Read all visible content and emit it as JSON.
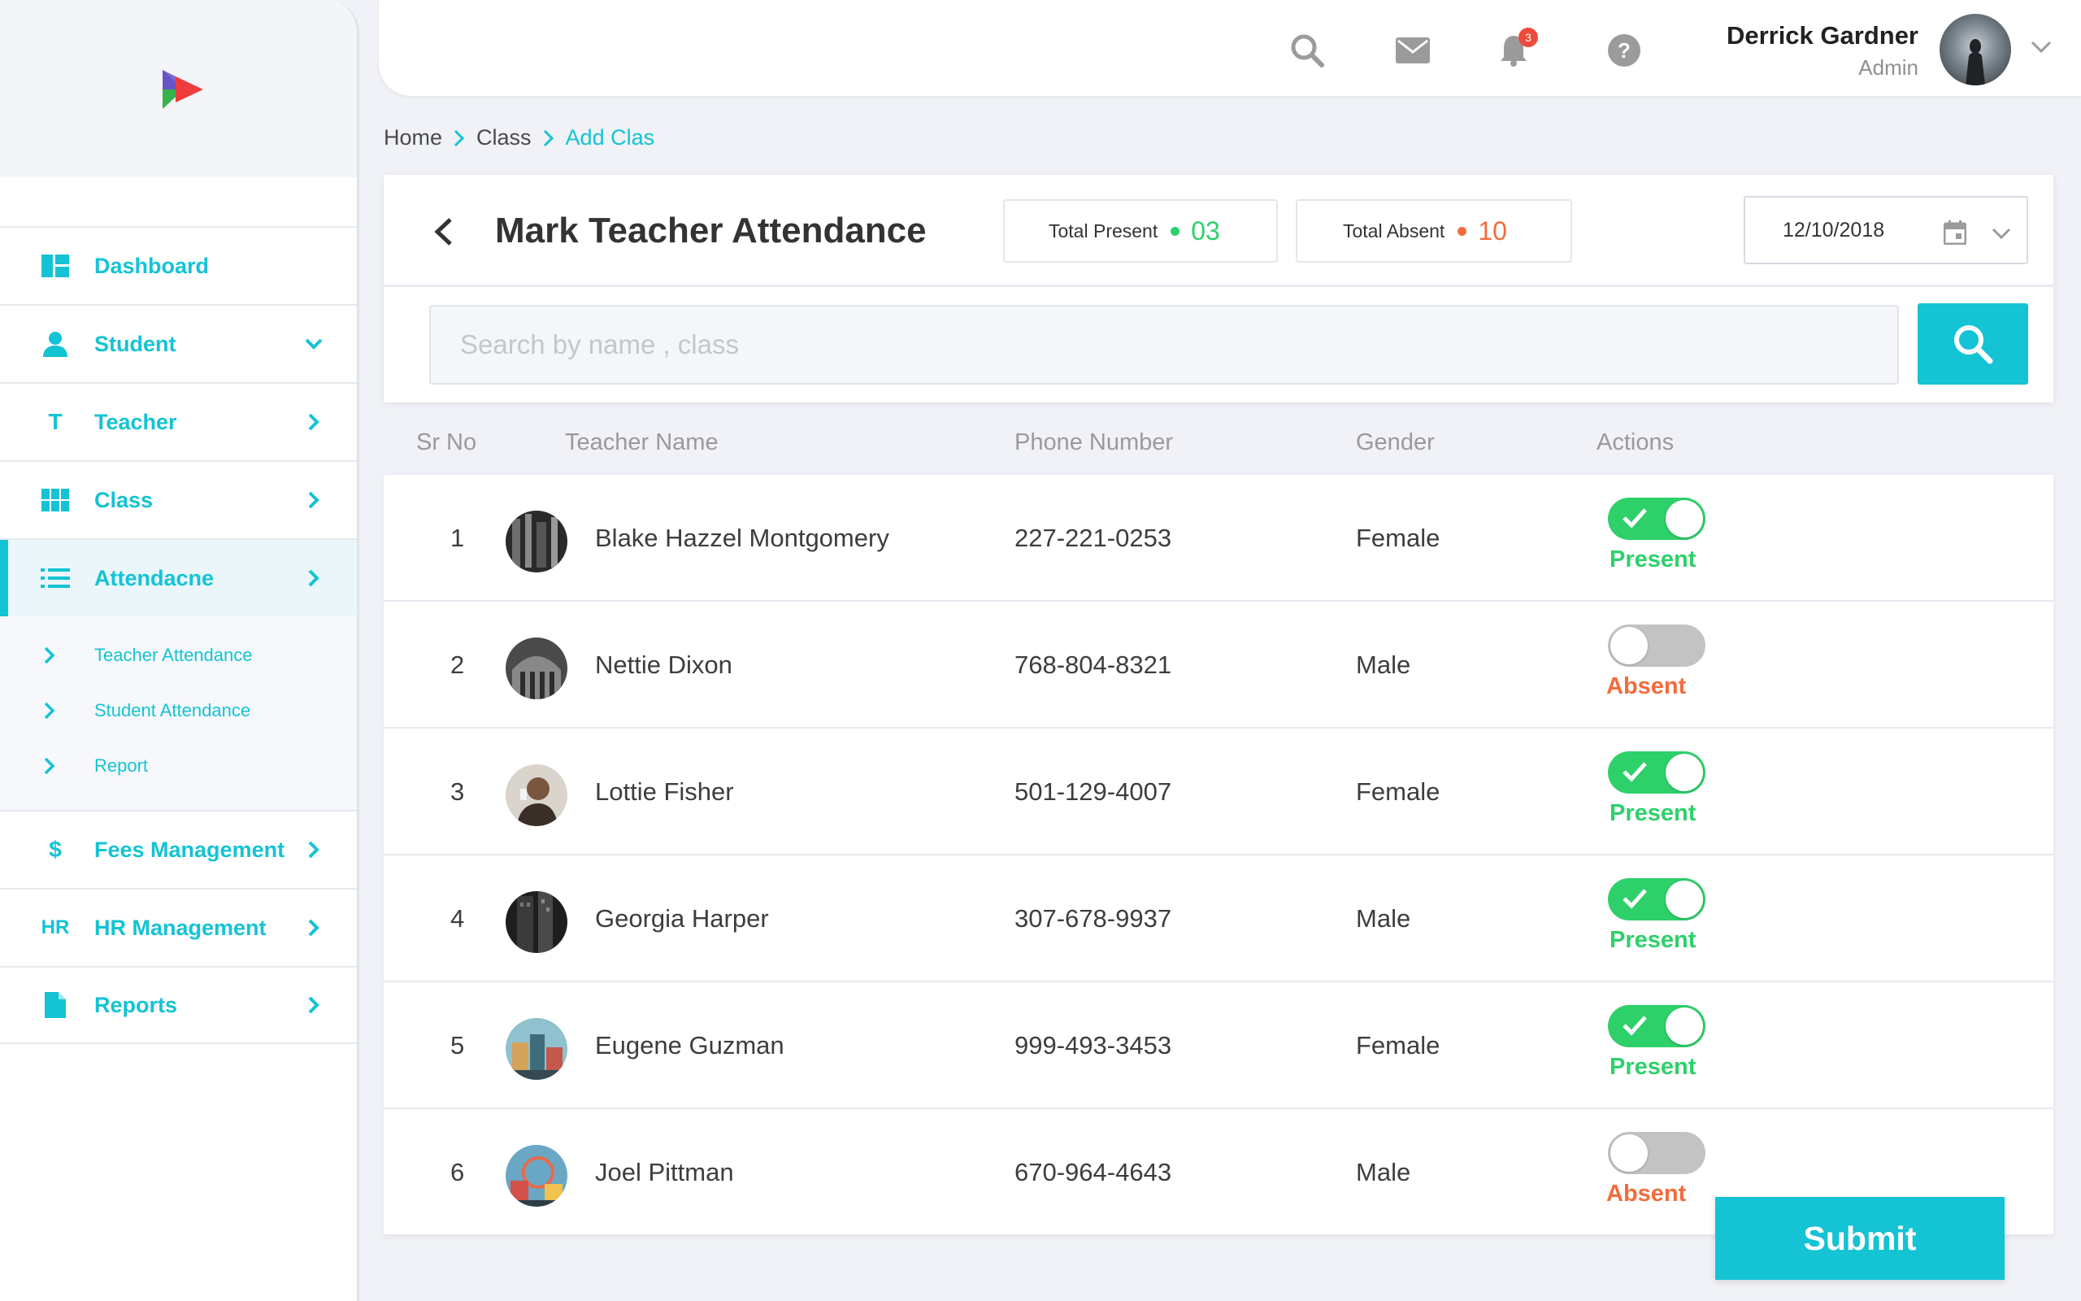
{
  "colors": {
    "accent": "#14c3d4",
    "present": "#2ed06a",
    "absent": "#f36c3c",
    "badge": "#ef4b3c"
  },
  "sidebar": {
    "items": [
      {
        "label": "Dashboard",
        "icon": "dashboard-icon"
      },
      {
        "label": "Student",
        "icon": "person-icon",
        "chevron": "chevron-down-icon"
      },
      {
        "label": "Teacher",
        "icon": "T",
        "chevron": "chevron-right-icon"
      },
      {
        "label": "Class",
        "icon": "grid-icon",
        "chevron": "chevron-right-icon"
      },
      {
        "label": "Attendacne",
        "icon": "list-icon",
        "chevron": "chevron-right-icon",
        "active": true
      },
      {
        "label": "Fees Management",
        "icon": "$",
        "chevron": "chevron-right-icon"
      },
      {
        "label": "HR Management",
        "icon": "HR",
        "chevron": "chevron-right-icon"
      },
      {
        "label": "Reports",
        "icon": "document-icon",
        "chevron": "chevron-right-icon"
      }
    ],
    "subitems": [
      {
        "label": "Teacher Attendance"
      },
      {
        "label": "Student Attendance"
      },
      {
        "label": "Report"
      }
    ]
  },
  "topbar": {
    "notification_count": "3",
    "user": {
      "name": "Derrick Gardner",
      "role": "Admin"
    }
  },
  "breadcrumb": {
    "home": "Home",
    "class": "Class",
    "current": "Add Clas"
  },
  "header": {
    "title": "Mark Teacher Attendance",
    "total_present_label": "Total Present",
    "total_present_value": "03",
    "total_absent_label": "Total Absent",
    "total_absent_value": "10",
    "date": "12/10/2018"
  },
  "search": {
    "placeholder": "Search by name , class"
  },
  "table": {
    "columns": [
      "Sr No",
      "Teacher Name",
      "Phone Number",
      "Gender",
      "Actions"
    ],
    "rows": [
      {
        "sr": "1",
        "name": "Blake Hazzel Montgomery",
        "phone": "227-221-0253",
        "gender": "Female",
        "status": "Present"
      },
      {
        "sr": "2",
        "name": "Nettie Dixon",
        "phone": "768-804-8321",
        "gender": "Male",
        "status": "Absent"
      },
      {
        "sr": "3",
        "name": "Lottie Fisher",
        "phone": "501-129-4007",
        "gender": "Female",
        "status": "Present"
      },
      {
        "sr": "4",
        "name": "Georgia Harper",
        "phone": "307-678-9937",
        "gender": "Male",
        "status": "Present"
      },
      {
        "sr": "5",
        "name": "Eugene Guzman",
        "phone": "999-493-3453",
        "gender": "Female",
        "status": "Present"
      },
      {
        "sr": "6",
        "name": "Joel Pittman",
        "phone": "670-964-4643",
        "gender": "Male",
        "status": "Absent"
      }
    ]
  },
  "submit_label": "Submit"
}
